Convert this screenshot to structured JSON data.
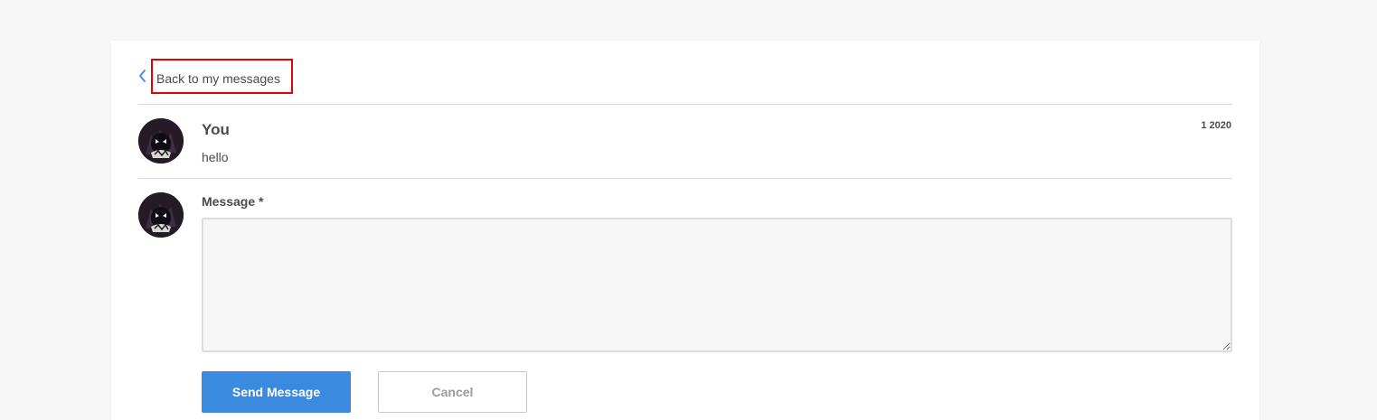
{
  "navigation": {
    "back_label": "Back to my messages"
  },
  "message": {
    "author": "You",
    "date": "1 2020",
    "text": "hello"
  },
  "reply_form": {
    "field_label": "Message *",
    "message_value": "",
    "send_label": "Send Message",
    "cancel_label": "Cancel"
  },
  "colors": {
    "accent": "#3a8be0",
    "highlight_border": "#e60000",
    "page_background": "#f6f6f6"
  }
}
